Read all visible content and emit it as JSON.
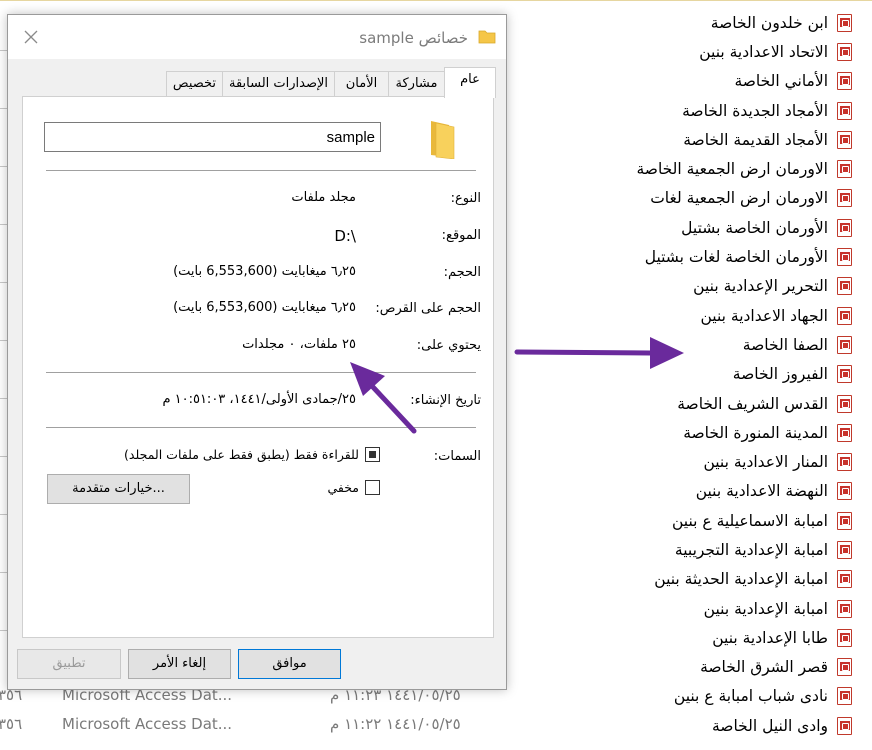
{
  "dialog": {
    "title": "خصائص sample",
    "tabs": [
      {
        "label": "عام"
      },
      {
        "label": "مشاركة"
      },
      {
        "label": "الأمان"
      },
      {
        "label": "الإصدارات السابقة"
      },
      {
        "label": "تخصيص"
      }
    ],
    "name_value": "sample",
    "fields": {
      "type": {
        "label": "النوع:",
        "value": "مجلد ملفات"
      },
      "location": {
        "label": "الموقع:",
        "value": "D:\\"
      },
      "size": {
        "label": "الحجم:",
        "value": "٦٫٢٥ ميغابايت (6,553,600 بايت)"
      },
      "size_on_disk": {
        "label": "الحجم على القرص:",
        "value": "٦٫٢٥ ميغابايت (6,553,600 بايت)"
      },
      "contains": {
        "label": "يحتوي على:",
        "value": "٢٥ ملفات، ٠ مجلدات"
      },
      "created": {
        "label": "تاريخ الإنشاء:",
        "value": "٢٥/جمادى الأولى/١٤٤١، ١٠:٥١:٠٣ م"
      }
    },
    "attributes": {
      "label": "السمات:",
      "readonly_label": "للقراءة فقط (يطبق فقط على ملفات المجلد)",
      "hidden_label": "مخفي",
      "advanced_button": "خيارات متقدمة..."
    },
    "buttons": {
      "ok": "موافق",
      "cancel": "إلغاء الأمر",
      "apply": "تطبيق"
    }
  },
  "file_list": [
    "ابن خلدون الخاصة",
    "الاتحاد الاعدادية بنين",
    "الأماني الخاصة",
    "الأمجاد الجديدة الخاصة",
    "الأمجاد القديمة الخاصة",
    "الاورمان ارض الجمعية الخاصة",
    "الاورمان ارض الجمعية لغات",
    "الأورمان الخاصة بشتيل",
    "الأورمان الخاصة لغات بشتيل",
    "التحرير الإعدادية بنين",
    "الجهاد الاعدادية بنين",
    "الصفا الخاصة",
    "الفيروز الخاصة",
    "القدس الشريف الخاصة",
    "المدينة المنورة الخاصة",
    "المنار الاعدادية بنين",
    "النهضة الاعدادية بنين",
    "امبابة الاسماعيلية ع بنين",
    "امبابة الإعدادية التجريبية",
    "امبابة الإعدادية الحديثة بنين",
    "امبابة الإعدادية بنين",
    "طابا الإعدادية بنين",
    "قصر الشرق الخاصة",
    "نادى شباب امبابة ع بنين",
    "وادى النيل الخاصة"
  ],
  "detail_rows": [
    {
      "num": "٣٥٦",
      "type": "Microsoft Access Dat...",
      "date": "١٤٤١/٠٥/٢٥ ١١:٢٣ م"
    },
    {
      "num": "٣٥٦",
      "type": "Microsoft Access Dat...",
      "date": "١٤٤١/٠٥/٢٥ ١١:٢٢ م"
    }
  ],
  "colors": {
    "arrow": "#6a2a9c",
    "pdf_icon": "#c7322b",
    "folder": "#f5c648"
  }
}
